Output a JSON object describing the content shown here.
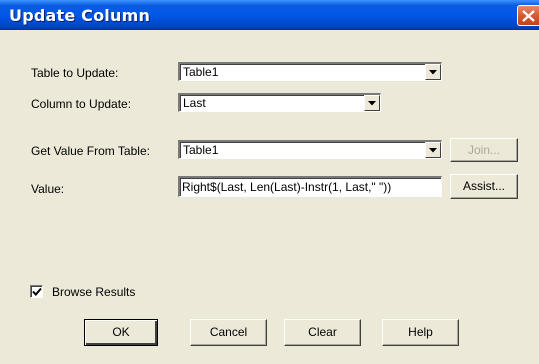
{
  "window": {
    "title": "Update Column",
    "close_icon": "close-icon"
  },
  "form": {
    "table_label": "Table to Update:",
    "table_value": "Table1",
    "column_label": "Column to Update:",
    "column_value": "Last",
    "get_value_label": "Get Value From Table:",
    "get_value_value": "Table1",
    "join_label": "Join...",
    "value_label": "Value:",
    "value_text": "Right$(Last, Len(Last)-Instr(1, Last,\" \"))",
    "assist_label": "Assist..."
  },
  "options": {
    "browse_label": "Browse Results",
    "browse_checked": true
  },
  "buttons": {
    "ok": "OK",
    "cancel": "Cancel",
    "clear": "Clear",
    "help": "Help"
  }
}
